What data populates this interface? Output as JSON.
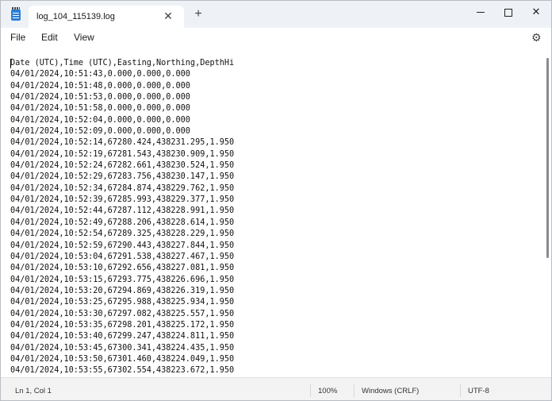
{
  "window": {
    "tab_title": "log_104_115139.log",
    "tab_close_glyph": "✕",
    "new_tab_glyph": "+",
    "close_glyph": "✕"
  },
  "menu": {
    "file": "File",
    "edit": "Edit",
    "view": "View",
    "settings_glyph": "⚙"
  },
  "editor": {
    "lines": [
      "Date (UTC),Time (UTC),Easting,Northing,DepthHi",
      "04/01/2024,10:51:43,0.000,0.000,0.000",
      "04/01/2024,10:51:48,0.000,0.000,0.000",
      "04/01/2024,10:51:53,0.000,0.000,0.000",
      "04/01/2024,10:51:58,0.000,0.000,0.000",
      "04/01/2024,10:52:04,0.000,0.000,0.000",
      "04/01/2024,10:52:09,0.000,0.000,0.000",
      "04/01/2024,10:52:14,67280.424,438231.295,1.950",
      "04/01/2024,10:52:19,67281.543,438230.909,1.950",
      "04/01/2024,10:52:24,67282.661,438230.524,1.950",
      "04/01/2024,10:52:29,67283.756,438230.147,1.950",
      "04/01/2024,10:52:34,67284.874,438229.762,1.950",
      "04/01/2024,10:52:39,67285.993,438229.377,1.950",
      "04/01/2024,10:52:44,67287.112,438228.991,1.950",
      "04/01/2024,10:52:49,67288.206,438228.614,1.950",
      "04/01/2024,10:52:54,67289.325,438228.229,1.950",
      "04/01/2024,10:52:59,67290.443,438227.844,1.950",
      "04/01/2024,10:53:04,67291.538,438227.467,1.950",
      "04/01/2024,10:53:10,67292.656,438227.081,1.950",
      "04/01/2024,10:53:15,67293.775,438226.696,1.950",
      "04/01/2024,10:53:20,67294.869,438226.319,1.950",
      "04/01/2024,10:53:25,67295.988,438225.934,1.950",
      "04/01/2024,10:53:30,67297.082,438225.557,1.950",
      "04/01/2024,10:53:35,67298.201,438225.172,1.950",
      "04/01/2024,10:53:40,67299.247,438224.811,1.950",
      "04/01/2024,10:53:45,67300.341,438224.435,1.950",
      "04/01/2024,10:53:50,67301.460,438224.049,1.950",
      "04/01/2024,10:53:55,67302.554,438223.672,1.950"
    ]
  },
  "status": {
    "position": "Ln 1, Col 1",
    "zoom": "100%",
    "line_ending": "Windows (CRLF)",
    "encoding": "UTF-8"
  }
}
